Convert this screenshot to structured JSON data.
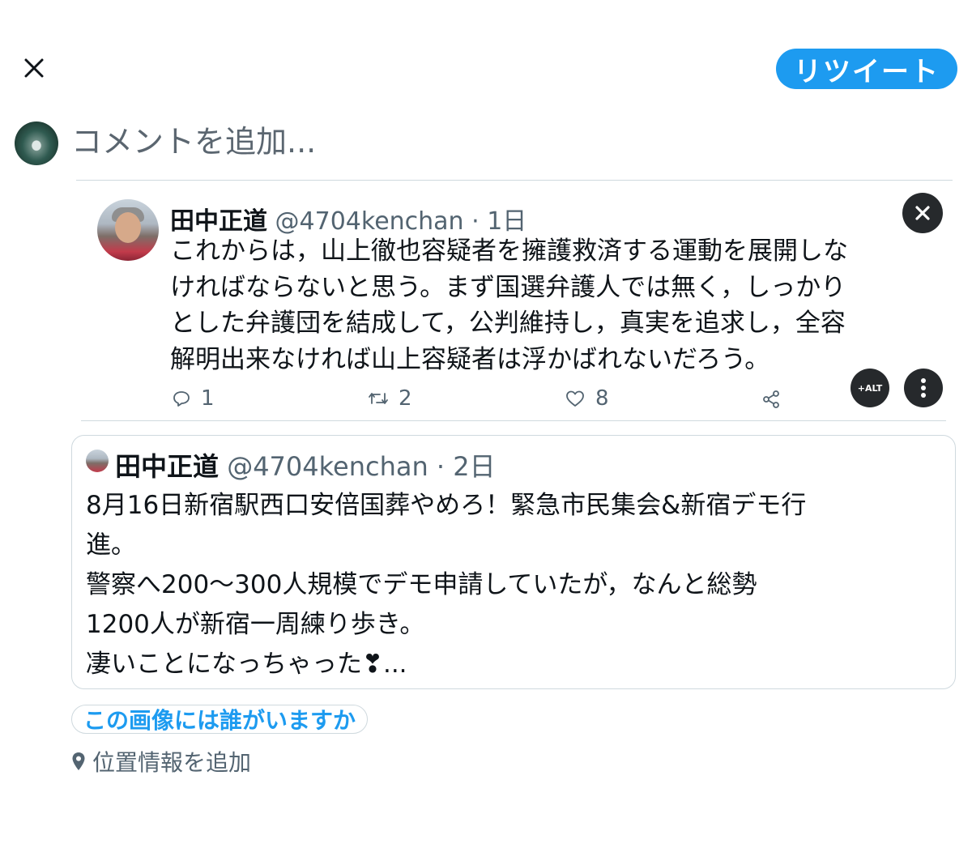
{
  "header": {
    "close_icon": "close-icon",
    "retweet_label": "リツイート",
    "accent_color": "#1d9bf0"
  },
  "composer": {
    "placeholder": "コメントを追加..."
  },
  "media_tweet": {
    "name": "田中正道",
    "handle": "@4704kenchan",
    "time": "1日",
    "text_lines": [
      "これからは，山上徹也容疑者を擁護救済する運動を展開しな",
      "ければならないと思う。まず国選弁護人では無く，しっかり",
      "とした弁護団を結成して，公判維持し，真実を追求し，全容",
      "解明出来なければ山上容疑者は浮かばれないだろう。"
    ],
    "reply_count": "1",
    "retweet_count": "2",
    "like_count": "8",
    "alt_label": "+ALT"
  },
  "quote_tweet": {
    "name": "田中正道",
    "handle": "@4704kenchan",
    "time": "2日",
    "text_lines": [
      "8月16日新宿駅西口安倍国葬やめろ！緊急市民集会&新宿デモ行",
      "進。",
      "警察へ200〜300人規模でデモ申請していたが，なんと総勢",
      "1200人が新宿一周練り歩き。",
      "凄いことになっちゃった❣..."
    ]
  },
  "footer": {
    "tag_people_label": "この画像には誰がいますか",
    "location_label": "位置情報を追加"
  }
}
